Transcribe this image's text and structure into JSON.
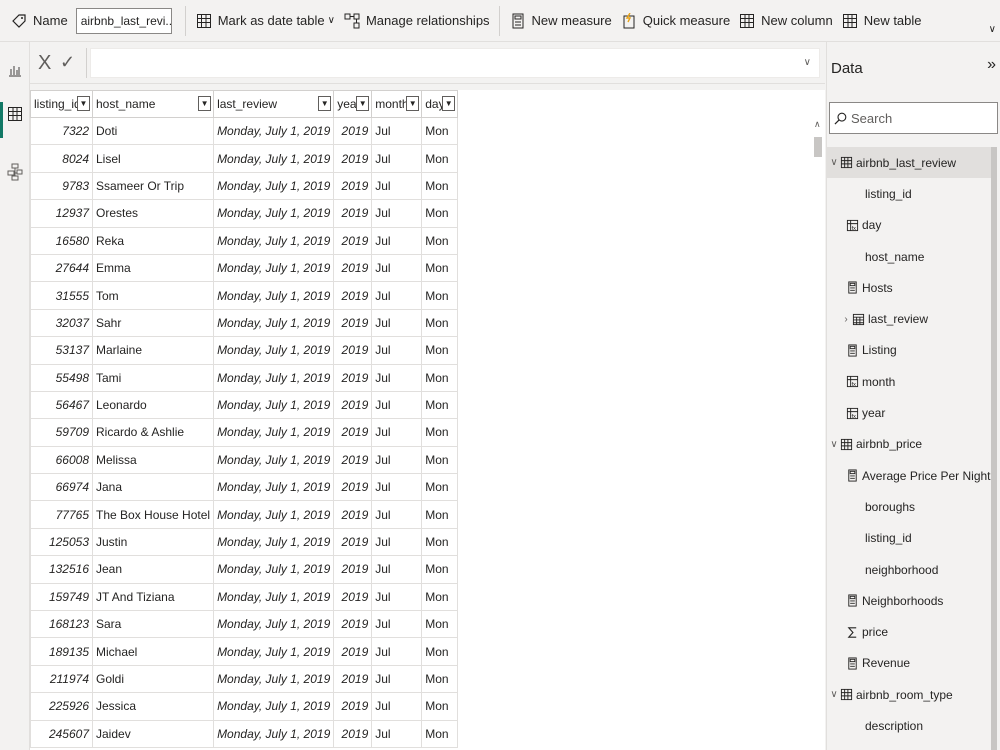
{
  "ribbon": {
    "name_label": "Name",
    "name_value": "airbnb_last_revi...",
    "mark_as_date_table": "Mark as date table",
    "manage_relationships": "Manage relationships",
    "new_measure": "New measure",
    "quick_measure": "Quick measure",
    "new_column": "New column",
    "new_table": "New table"
  },
  "formula_bar": {
    "cancel": "X",
    "commit": "✓",
    "value": ""
  },
  "table": {
    "columns": [
      "listing_id",
      "host_name",
      "last_review",
      "year",
      "month",
      "day"
    ],
    "rows": [
      [
        "7322",
        "Doti",
        "Monday, July 1, 2019",
        "2019",
        "Jul",
        "Mon"
      ],
      [
        "8024",
        "Lisel",
        "Monday, July 1, 2019",
        "2019",
        "Jul",
        "Mon"
      ],
      [
        "9783",
        "Ssameer Or Trip",
        "Monday, July 1, 2019",
        "2019",
        "Jul",
        "Mon"
      ],
      [
        "12937",
        "Orestes",
        "Monday, July 1, 2019",
        "2019",
        "Jul",
        "Mon"
      ],
      [
        "16580",
        "Reka",
        "Monday, July 1, 2019",
        "2019",
        "Jul",
        "Mon"
      ],
      [
        "27644",
        "Emma",
        "Monday, July 1, 2019",
        "2019",
        "Jul",
        "Mon"
      ],
      [
        "31555",
        "Tom",
        "Monday, July 1, 2019",
        "2019",
        "Jul",
        "Mon"
      ],
      [
        "32037",
        "Sahr",
        "Monday, July 1, 2019",
        "2019",
        "Jul",
        "Mon"
      ],
      [
        "53137",
        "Marlaine",
        "Monday, July 1, 2019",
        "2019",
        "Jul",
        "Mon"
      ],
      [
        "55498",
        "Tami",
        "Monday, July 1, 2019",
        "2019",
        "Jul",
        "Mon"
      ],
      [
        "56467",
        "Leonardo",
        "Monday, July 1, 2019",
        "2019",
        "Jul",
        "Mon"
      ],
      [
        "59709",
        "Ricardo & Ashlie",
        "Monday, July 1, 2019",
        "2019",
        "Jul",
        "Mon"
      ],
      [
        "66008",
        "Melissa",
        "Monday, July 1, 2019",
        "2019",
        "Jul",
        "Mon"
      ],
      [
        "66974",
        "Jana",
        "Monday, July 1, 2019",
        "2019",
        "Jul",
        "Mon"
      ],
      [
        "77765",
        "The Box House Hotel",
        "Monday, July 1, 2019",
        "2019",
        "Jul",
        "Mon"
      ],
      [
        "125053",
        "Justin",
        "Monday, July 1, 2019",
        "2019",
        "Jul",
        "Mon"
      ],
      [
        "132516",
        "Jean",
        "Monday, July 1, 2019",
        "2019",
        "Jul",
        "Mon"
      ],
      [
        "159749",
        "JT And Tiziana",
        "Monday, July 1, 2019",
        "2019",
        "Jul",
        "Mon"
      ],
      [
        "168123",
        "Sara",
        "Monday, July 1, 2019",
        "2019",
        "Jul",
        "Mon"
      ],
      [
        "189135",
        "Michael",
        "Monday, July 1, 2019",
        "2019",
        "Jul",
        "Mon"
      ],
      [
        "211974",
        "Goldi",
        "Monday, July 1, 2019",
        "2019",
        "Jul",
        "Mon"
      ],
      [
        "225926",
        "Jessica",
        "Monday, July 1, 2019",
        "2019",
        "Jul",
        "Mon"
      ],
      [
        "245607",
        "Jaidev",
        "Monday, July 1, 2019",
        "2019",
        "Jul",
        "Mon"
      ]
    ]
  },
  "data_pane": {
    "title": "Data",
    "search_placeholder": "Search",
    "items": [
      {
        "label": "airbnb_last_review",
        "level": 0,
        "icon": "table-icon",
        "expand": "v",
        "selected": true
      },
      {
        "label": "listing_id",
        "level": 2,
        "icon": "",
        "expand": ""
      },
      {
        "label": "day",
        "level": 1,
        "icon": "calculated-column-icon",
        "expand": ""
      },
      {
        "label": "host_name",
        "level": 2,
        "icon": "",
        "expand": ""
      },
      {
        "label": "Hosts",
        "level": 1,
        "icon": "measure-icon",
        "expand": ""
      },
      {
        "label": "last_review",
        "level": 1,
        "icon": "date-hierarchy-icon",
        "expand": ">"
      },
      {
        "label": "Listing",
        "level": 1,
        "icon": "measure-icon",
        "expand": ""
      },
      {
        "label": "month",
        "level": 1,
        "icon": "calculated-column-icon",
        "expand": ""
      },
      {
        "label": "year",
        "level": 1,
        "icon": "calculated-column-icon",
        "expand": ""
      },
      {
        "label": "airbnb_price",
        "level": 0,
        "icon": "table-icon",
        "expand": "v"
      },
      {
        "label": "Average Price Per Night",
        "level": 1,
        "icon": "measure-icon",
        "expand": ""
      },
      {
        "label": "boroughs",
        "level": 2,
        "icon": "",
        "expand": ""
      },
      {
        "label": "listing_id",
        "level": 2,
        "icon": "",
        "expand": ""
      },
      {
        "label": "neighborhood",
        "level": 2,
        "icon": "",
        "expand": ""
      },
      {
        "label": "Neighborhoods",
        "level": 1,
        "icon": "measure-icon",
        "expand": ""
      },
      {
        "label": "price",
        "level": 1,
        "icon": "sum-icon",
        "expand": ""
      },
      {
        "label": "Revenue",
        "level": 1,
        "icon": "measure-icon",
        "expand": ""
      },
      {
        "label": "airbnb_room_type",
        "level": 0,
        "icon": "table-icon",
        "expand": "v"
      },
      {
        "label": "description",
        "level": 2,
        "icon": "",
        "expand": ""
      }
    ]
  },
  "colors": {
    "accent": "#117865",
    "grid_border": "#e1dfdd",
    "background": "#f3f2f1"
  }
}
